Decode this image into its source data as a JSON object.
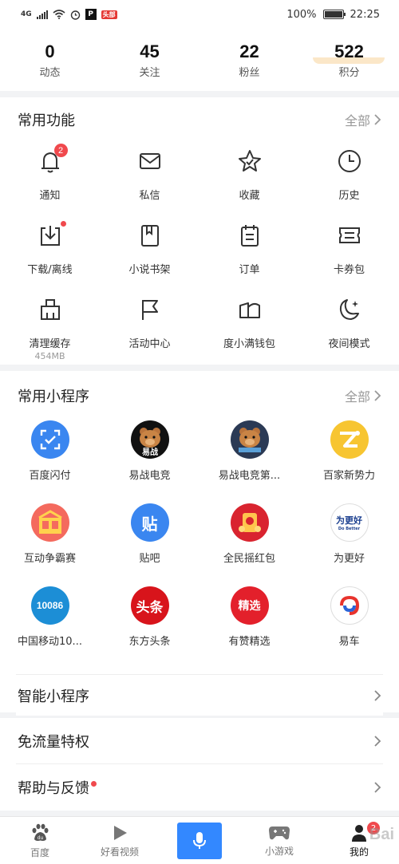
{
  "status": {
    "network": "4G",
    "app_badge": "头部",
    "battery": "100%",
    "time": "22:25"
  },
  "stats": [
    {
      "value": "0",
      "label": "动态"
    },
    {
      "value": "45",
      "label": "关注"
    },
    {
      "value": "22",
      "label": "粉丝"
    },
    {
      "value": "522",
      "label": "积分"
    }
  ],
  "common": {
    "title": "常用功能",
    "more": "全部",
    "items": [
      {
        "label": "通知",
        "icon": "bell-icon",
        "badge": "2"
      },
      {
        "label": "私信",
        "icon": "mail-icon"
      },
      {
        "label": "收藏",
        "icon": "star-icon"
      },
      {
        "label": "历史",
        "icon": "clock-icon"
      },
      {
        "label": "下载/离线",
        "icon": "download-icon",
        "dot": true
      },
      {
        "label": "小说书架",
        "icon": "book-icon"
      },
      {
        "label": "订单",
        "icon": "order-icon"
      },
      {
        "label": "卡券包",
        "icon": "coupon-icon"
      },
      {
        "label": "清理缓存",
        "sub": "454MB",
        "icon": "broom-icon"
      },
      {
        "label": "活动中心",
        "icon": "flag-icon"
      },
      {
        "label": "度小满钱包",
        "icon": "wallet-icon"
      },
      {
        "label": "夜间模式",
        "icon": "moon-icon"
      }
    ]
  },
  "mini": {
    "title": "常用小程序",
    "more": "全部",
    "items": [
      {
        "label": "百度闪付",
        "icon": "scan-pay-icon",
        "color": "#3a86f0"
      },
      {
        "label": "易战电竞",
        "icon": "bear-icon",
        "color": "#111111",
        "text": "易战"
      },
      {
        "label": "易战电竞第...",
        "icon": "bear-icon",
        "color": "#2b3a55"
      },
      {
        "label": "百家新势力",
        "icon": "baijia-icon",
        "color": "#f7c531"
      },
      {
        "label": "互动争霸赛",
        "icon": "gift-icon",
        "color": "#f46a5e"
      },
      {
        "label": "贴吧",
        "icon": "tieba-icon",
        "color": "#3a86f0",
        "text": "贴"
      },
      {
        "label": "全民摇红包",
        "icon": "redpacket-icon",
        "color": "#d9242f"
      },
      {
        "label": "为更好",
        "icon": "better-icon",
        "color": "#ffffff",
        "text": "为更好"
      },
      {
        "label": "中国移动10...",
        "icon": "cmcc-icon",
        "color": "#1c8ed6",
        "text": "10086"
      },
      {
        "label": "东方头条",
        "icon": "toutiao-icon",
        "color": "#d8141b",
        "text": "头条"
      },
      {
        "label": "有赞精选",
        "icon": "youzan-icon",
        "color": "#e3202b",
        "text": "精选"
      },
      {
        "label": "易车",
        "icon": "yiche-icon",
        "color": "#ffffff"
      }
    ]
  },
  "rows": [
    {
      "label": "智能小程序",
      "dot": false
    },
    {
      "label": "免流量特权",
      "dot": false
    },
    {
      "label": "帮助与反馈",
      "dot": true
    }
  ],
  "tabs": [
    {
      "label": "百度",
      "icon": "paw-icon"
    },
    {
      "label": "好看视频",
      "icon": "play-icon"
    },
    {
      "label": "",
      "icon": "mic-icon"
    },
    {
      "label": "小游戏",
      "icon": "gamepad-icon"
    },
    {
      "label": "我的",
      "icon": "user-icon",
      "badge": "2"
    }
  ],
  "watermark": "Bai"
}
